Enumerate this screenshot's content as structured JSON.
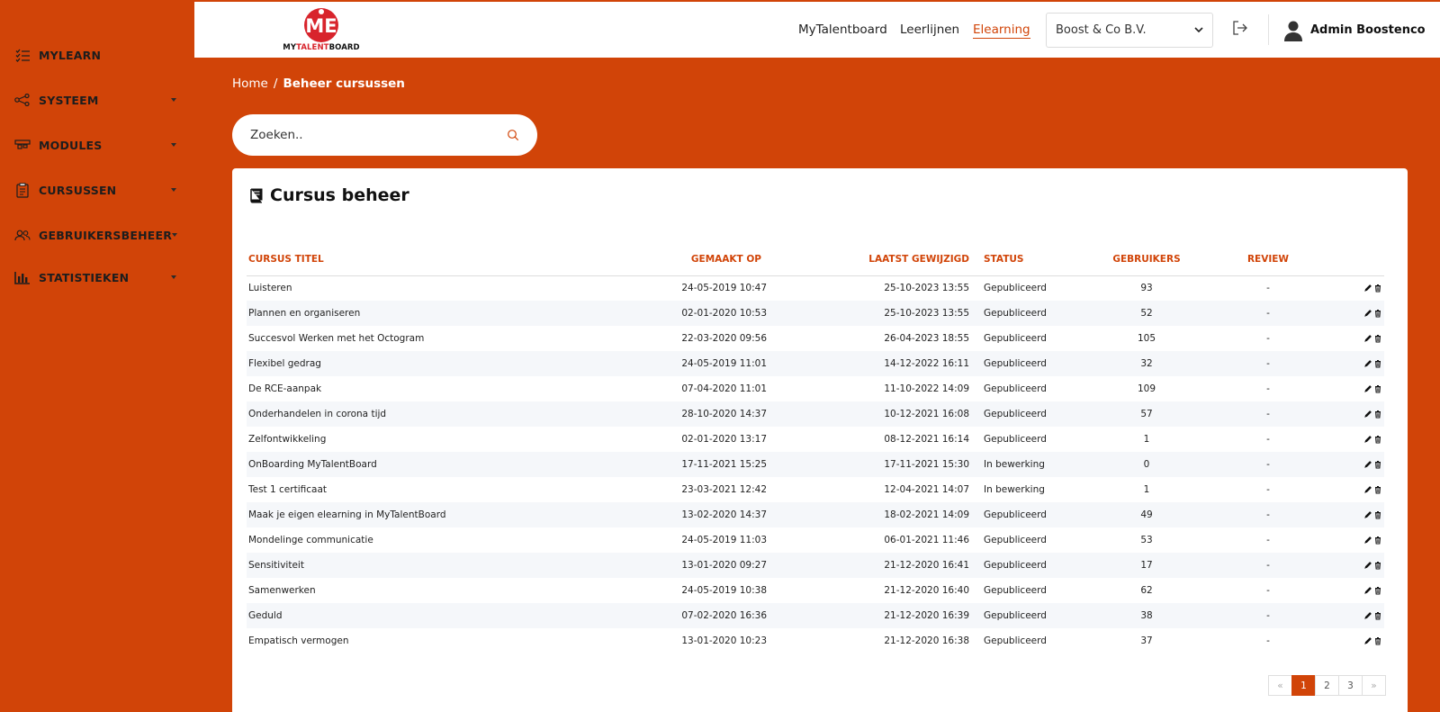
{
  "sidebar": {
    "items": [
      {
        "label": "MYLEARN",
        "icon": "checklist-icon",
        "has_caret": false
      },
      {
        "label": "SYSTEEM",
        "icon": "share-nodes-icon",
        "has_caret": true
      },
      {
        "label": "MODULES",
        "icon": "modules-icon",
        "has_caret": true
      },
      {
        "label": "CURSUSSEN",
        "icon": "clipboard-icon",
        "has_caret": true
      },
      {
        "label": "GEBRUIKERSBEHEER",
        "icon": "users-icon",
        "has_caret": true
      },
      {
        "label": "STATISTIEKEN",
        "icon": "bar-chart-icon",
        "has_caret": true
      }
    ]
  },
  "header": {
    "logo": {
      "text_prefix": "MY",
      "text_highlight": "TALENT",
      "text_suffix": "BOARD",
      "brand_color": "#d8242c"
    },
    "nav": [
      {
        "label": "MyTalentboard",
        "active": false
      },
      {
        "label": "Leerlijnen",
        "active": false
      },
      {
        "label": "Elearning",
        "active": true
      }
    ],
    "org_select": {
      "value": "Boost & Co B.V."
    },
    "user": {
      "name": "Admin Boostenco"
    }
  },
  "breadcrumb": {
    "home": "Home",
    "separator": "/",
    "current": "Beheer cursussen"
  },
  "search": {
    "placeholder": "Zoeken.."
  },
  "card": {
    "title": "Cursus beheer",
    "columns": [
      "CURSUS TITEL",
      "GEMAAKT OP",
      "LAATST GEWIJZIGD",
      "STATUS",
      "GEBRUIKERS",
      "REVIEW"
    ],
    "rows": [
      {
        "title": "Luisteren",
        "made": "24-05-2019 10:47",
        "modified": "25-10-2023 13:55",
        "status": "Gepubliceerd",
        "users": "93",
        "review": "-"
      },
      {
        "title": "Plannen en organiseren",
        "made": "02-01-2020 10:53",
        "modified": "25-10-2023 13:55",
        "status": "Gepubliceerd",
        "users": "52",
        "review": "-"
      },
      {
        "title": "Succesvol Werken met het Octogram",
        "made": "22-03-2020 09:56",
        "modified": "26-04-2023 18:55",
        "status": "Gepubliceerd",
        "users": "105",
        "review": "-"
      },
      {
        "title": "Flexibel gedrag",
        "made": "24-05-2019 11:01",
        "modified": "14-12-2022 16:11",
        "status": "Gepubliceerd",
        "users": "32",
        "review": "-"
      },
      {
        "title": "De RCE-aanpak",
        "made": "07-04-2020 11:01",
        "modified": "11-10-2022 14:09",
        "status": "Gepubliceerd",
        "users": "109",
        "review": "-"
      },
      {
        "title": "Onderhandelen in corona tijd",
        "made": "28-10-2020 14:37",
        "modified": "10-12-2021 16:08",
        "status": "Gepubliceerd",
        "users": "57",
        "review": "-"
      },
      {
        "title": "Zelfontwikkeling",
        "made": "02-01-2020 13:17",
        "modified": "08-12-2021 16:14",
        "status": "Gepubliceerd",
        "users": "1",
        "review": "-"
      },
      {
        "title": "OnBoarding MyTalentBoard",
        "made": "17-11-2021 15:25",
        "modified": "17-11-2021 15:30",
        "status": "In bewerking",
        "users": "0",
        "review": "-"
      },
      {
        "title": "Test 1 certificaat",
        "made": "23-03-2021 12:42",
        "modified": "12-04-2021 14:07",
        "status": "In bewerking",
        "users": "1",
        "review": "-"
      },
      {
        "title": "Maak je eigen elearning in MyTalentBoard",
        "made": "13-02-2020 14:37",
        "modified": "18-02-2021 14:09",
        "status": "Gepubliceerd",
        "users": "49",
        "review": "-"
      },
      {
        "title": "Mondelinge communicatie",
        "made": "24-05-2019 11:03",
        "modified": "06-01-2021 11:46",
        "status": "Gepubliceerd",
        "users": "53",
        "review": "-"
      },
      {
        "title": "Sensitiviteit",
        "made": "13-01-2020 09:27",
        "modified": "21-12-2020 16:41",
        "status": "Gepubliceerd",
        "users": "17",
        "review": "-"
      },
      {
        "title": "Samenwerken",
        "made": "24-05-2019 10:38",
        "modified": "21-12-2020 16:40",
        "status": "Gepubliceerd",
        "users": "62",
        "review": "-"
      },
      {
        "title": "Geduld",
        "made": "07-02-2020 16:36",
        "modified": "21-12-2020 16:39",
        "status": "Gepubliceerd",
        "users": "38",
        "review": "-"
      },
      {
        "title": "Empatisch vermogen",
        "made": "13-01-2020 10:23",
        "modified": "21-12-2020 16:38",
        "status": "Gepubliceerd",
        "users": "37",
        "review": "-"
      }
    ]
  },
  "pagination": {
    "prev": "«",
    "pages": [
      "1",
      "2",
      "3"
    ],
    "active": "1",
    "next": "»"
  },
  "colors": {
    "accent": "#d14408",
    "brand_red": "#d8242c",
    "row_alt": "#f5f7fa"
  }
}
